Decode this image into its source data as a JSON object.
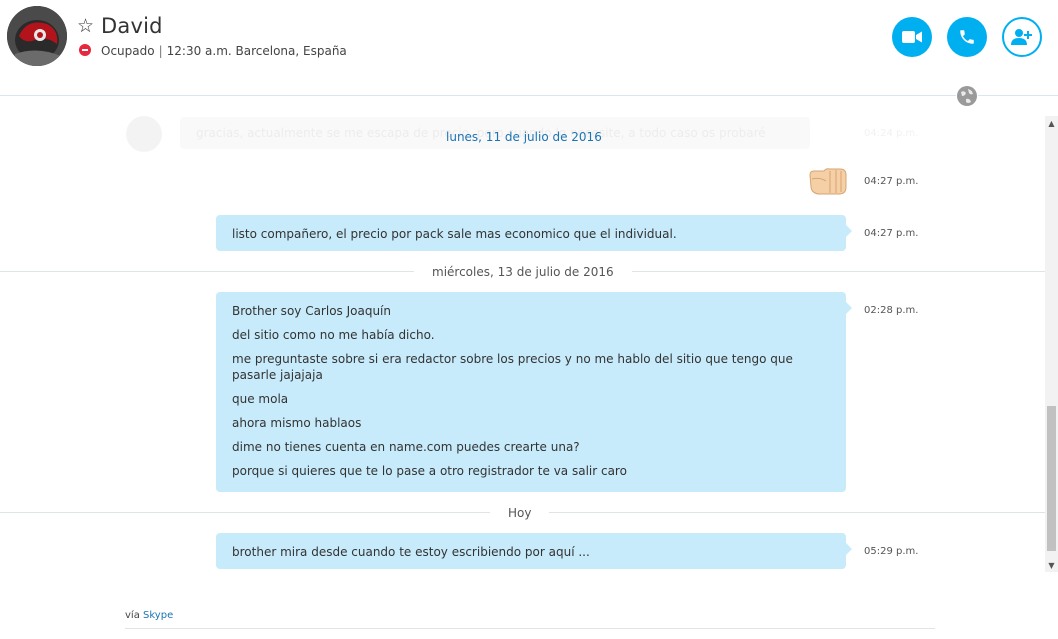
{
  "header": {
    "contact_name": "David",
    "status": "Ocupado",
    "local_time": "12:30 a.m. Barcelona, España",
    "separator": "|",
    "accent_color": "#00aff0",
    "status_color": "#e6273e",
    "buttons": {
      "video": "video-call-icon",
      "call": "phone-icon",
      "add": "add-contact-icon"
    }
  },
  "conversation": {
    "date_labels": {
      "first": "lunes, 11 de julio de 2016",
      "second": "miércoles, 13 de julio de 2016",
      "third": "Hoy"
    },
    "faded_message": {
      "text": "gracias, actualmente se me escapa de precio, pero cuando lo necesite, a todo caso os probaré",
      "time": "04:24 p.m."
    },
    "messages": [
      {
        "time": "04:27 p.m.",
        "emoticon": "fist-bump-icon"
      },
      {
        "lines": [
          "listo compañero, el precio por pack sale mas economico que el individual."
        ],
        "time": "04:27 p.m."
      },
      {
        "lines": [
          "Brother soy Carlos Joaquín",
          "del sitio como no me había dicho.",
          "me preguntaste sobre si era redactor sobre los precios y no me hablo del sitio que tengo que pasarle jajajaja",
          "que mola",
          "ahora mismo hablaos",
          "dime no tienes cuenta en name.com puedes crearte una?",
          "porque si quieres que te lo pase a otro registrador te va salir caro"
        ],
        "time": "02:28 p.m."
      },
      {
        "lines": [
          "brother mira desde cuando te estoy escribiendo por aquí ..."
        ],
        "time": "05:29 p.m."
      }
    ],
    "bubble_color": "#c7ebfa"
  },
  "footer": {
    "via_prefix": "vía",
    "via_link": "Skype"
  }
}
